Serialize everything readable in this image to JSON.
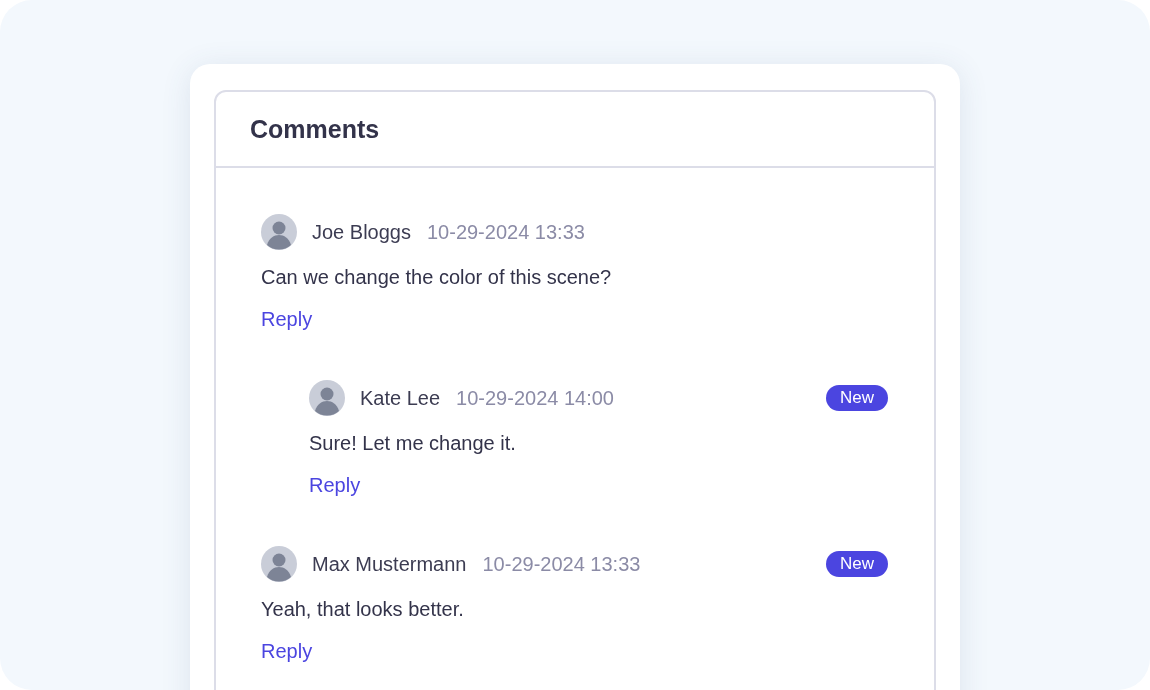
{
  "panel": {
    "title": "Comments"
  },
  "comments": [
    {
      "author": "Joe Bloggs",
      "time": "10-29-2024 13:33",
      "text": "Can we change the color of this scene?",
      "reply": "Reply",
      "children": [
        {
          "author": "Kate Lee",
          "time": "10-29-2024 14:00",
          "badge": "New",
          "text": "Sure! Let me change it.",
          "reply": "Reply"
        }
      ]
    },
    {
      "author": "Max Mustermann",
      "time": "10-29-2024 13:33",
      "badge": "New",
      "text": "Yeah, that looks better.",
      "reply": "Reply"
    }
  ]
}
